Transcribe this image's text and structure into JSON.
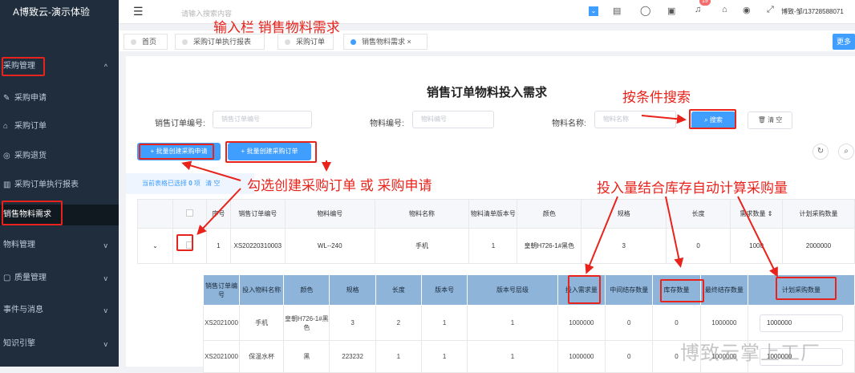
{
  "sidebar": {
    "brand": "A博致云-演示体验",
    "items": [
      {
        "label": "采购管理",
        "chev": "^"
      },
      {
        "label": "采购申请"
      },
      {
        "label": "采购订单"
      },
      {
        "label": "采购退货"
      },
      {
        "label": "采购订单执行报表"
      },
      {
        "label": "销售物料需求"
      },
      {
        "label": "物料管理",
        "chev": "v"
      },
      {
        "label": "质量管理",
        "chev": "v"
      },
      {
        "label": "事件与消息",
        "chev": "v"
      },
      {
        "label": "知识引擎",
        "chev": "v"
      }
    ]
  },
  "topbar": {
    "search_placeholder": "请输入搜索内容",
    "user": "博致-邹/13728588071",
    "badge": "19"
  },
  "tabs": [
    {
      "label": "首页"
    },
    {
      "label": "采购订单执行报表"
    },
    {
      "label": "采购订单"
    },
    {
      "label": "销售物料需求",
      "close": "×"
    }
  ],
  "more_label": "更多",
  "page_title": "销售订单物料投入需求",
  "filters": {
    "order_no_label": "销售订单编号:",
    "order_no_placeholder": "销售订单编号",
    "material_no_label": "物料编号:",
    "material_no_placeholder": "物料编号",
    "material_name_label": "物料名称:",
    "material_name_placeholder": "物料名称",
    "search_label": "搜索",
    "clear_label": "清 空"
  },
  "actions": {
    "batch_request": "批量创建采购申请",
    "batch_order": "批量创建采购订单"
  },
  "selection": {
    "prefix": "当前表格已选择",
    "count": "0",
    "suffix": "项",
    "clear": "清 空"
  },
  "main_table": {
    "headers": [
      "序号",
      "销售订单编号",
      "物料编号",
      "物料名称",
      "物料清单版本号",
      "颜色",
      "规格",
      "长度",
      "需求数量",
      "计划采购数量"
    ],
    "row": {
      "seq": "1",
      "order_no": "XS20220310003",
      "material_no": "WL--240",
      "material_name": "手机",
      "bom_version": "1",
      "color": "皇朝H726-1#黑色",
      "spec": "3",
      "length": "0",
      "demand_qty": "1000",
      "plan_qty": "2000000"
    }
  },
  "sub_table": {
    "headers": [
      "销售订单编号",
      "投入物料名称",
      "颜色",
      "规格",
      "长度",
      "版本号",
      "版本号层级",
      "投入需求量",
      "中间结存数量",
      "库存数量",
      "最终结存数量",
      "计划采购数量"
    ],
    "rows": [
      {
        "order_no": "XS2021000",
        "name": "手机",
        "color": "皇朝H726-1#黑色",
        "spec": "3",
        "length": "2",
        "ver": "1",
        "level": "1",
        "input_qty": "1000000",
        "mid_qty": "0",
        "stock_qty": "0",
        "final_qty": "1000000",
        "plan_qty": "1000000"
      },
      {
        "order_no": "XS2021000",
        "name": "保温水杯",
        "color": "黑",
        "spec": "223232",
        "length": "1",
        "ver": "1",
        "level": "1",
        "input_qty": "1000000",
        "mid_qty": "0",
        "stock_qty": "0",
        "final_qty": "1000000",
        "plan_qty": "1000000"
      }
    ]
  },
  "annotations": {
    "a1": "输入栏  销售物料需求",
    "a2": "按条件搜索",
    "a3": "勾选创建采购订单   或   采购申请",
    "a4": "投入量结合库存自动计算采购量"
  },
  "watermark": "博致云掌上工厂",
  "colors": {
    "primary": "#409eff",
    "annotation": "#e8231b",
    "sidebar": "#1f2d3d",
    "subheader": "#8fb4d9"
  }
}
